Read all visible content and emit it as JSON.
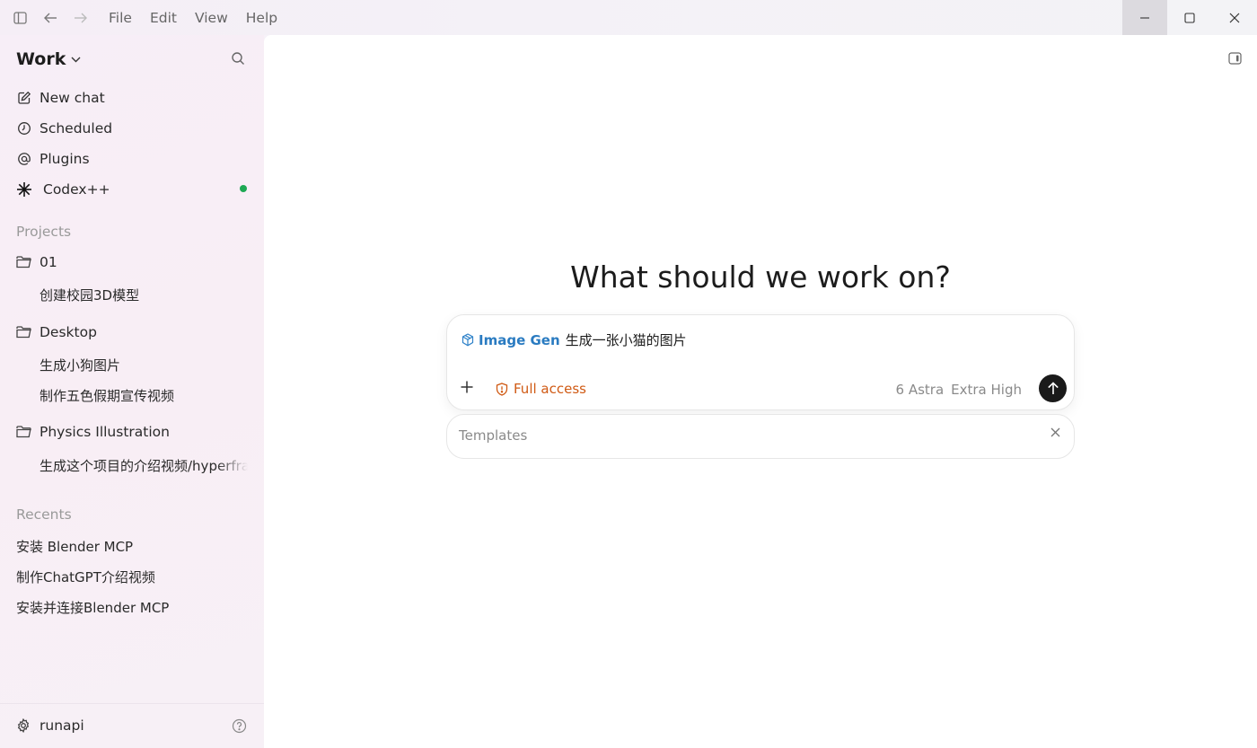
{
  "window": {
    "menu": [
      "File",
      "Edit",
      "View",
      "Help"
    ]
  },
  "sidebar": {
    "workspace": "Work",
    "nav": [
      {
        "label": "New chat",
        "icon": "edit-icon"
      },
      {
        "label": "Scheduled",
        "icon": "clock-icon"
      },
      {
        "label": "Plugins",
        "icon": "at-icon"
      },
      {
        "label": "Codex++",
        "icon": "asterisk-icon"
      }
    ],
    "projects_label": "Projects",
    "projects": [
      {
        "name": "01",
        "items": [
          "创建校园3D模型"
        ]
      },
      {
        "name": "Desktop",
        "items": [
          "生成小狗图片",
          "制作五色假期宣传视频"
        ]
      },
      {
        "name": "Physics Illustration",
        "items": [
          "生成这个项目的介绍视频/hyperframes"
        ]
      }
    ],
    "recents_label": "Recents",
    "recents": [
      "安装 Blender MCP",
      "制作ChatGPT介绍视频",
      "安装并连接Blender MCP"
    ],
    "user": "runapi"
  },
  "main": {
    "heading": "What should we work on?",
    "composer": {
      "tool_tag": "Image Gen",
      "prompt": "生成一张小猫的图片",
      "access": "Full access",
      "model": "6 Astra",
      "effort": "Extra High"
    },
    "templates": {
      "label": "Templates"
    }
  },
  "colors": {
    "accent_blue": "#2a7bc1",
    "access_orange": "#d05a14",
    "status_green": "#1ea854"
  }
}
